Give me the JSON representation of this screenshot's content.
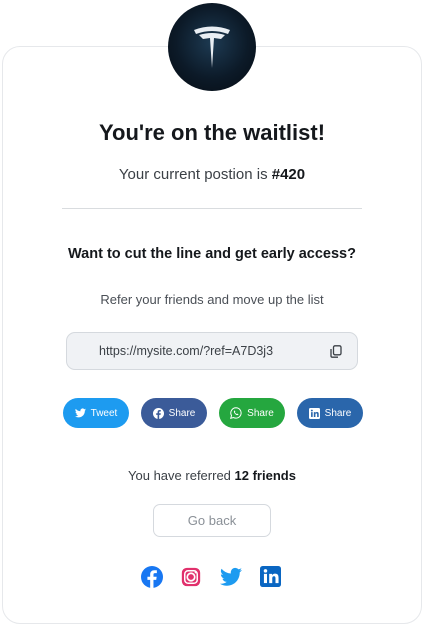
{
  "header": {
    "logo_icon": "tesla-logo-icon",
    "title": "You're on the waitlist!"
  },
  "position": {
    "prefix": "Your current postion is",
    "number": "#420"
  },
  "referral": {
    "question": "Want to cut the line and get early access?",
    "subtitle": "Refer your friends and move up the list",
    "link": "https://mysite.com/?ref=A7D3j3",
    "copy_icon": "copy-icon"
  },
  "share_buttons": [
    {
      "label": "Tweet",
      "icon": "twitter-icon",
      "color": "#1d9bf0"
    },
    {
      "label": "Share",
      "icon": "facebook-icon",
      "color": "#3b5b99"
    },
    {
      "label": "Share",
      "icon": "whatsapp-icon",
      "color": "#25a73f"
    },
    {
      "label": "Share",
      "icon": "linkedin-icon",
      "color": "#2a66ab"
    }
  ],
  "referred": {
    "prefix": "You have referred",
    "count": "12 friends"
  },
  "go_back_label": "Go back",
  "social_links": [
    {
      "icon": "facebook-icon",
      "color": "#1877f2"
    },
    {
      "icon": "instagram-icon",
      "color": "#e1306c"
    },
    {
      "icon": "twitter-icon",
      "color": "#1d9bf0"
    },
    {
      "icon": "linkedin-icon",
      "color": "#0a66c2"
    }
  ]
}
